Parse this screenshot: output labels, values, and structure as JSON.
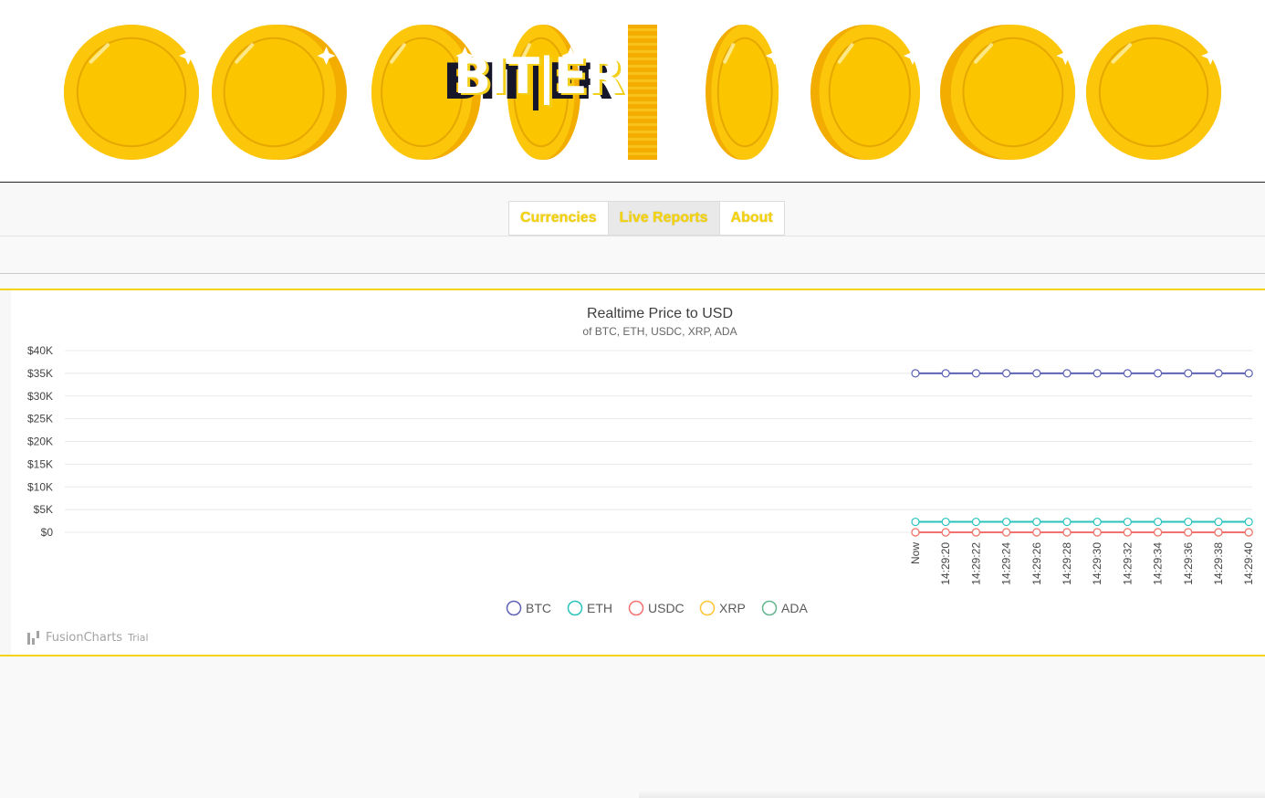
{
  "header": {
    "logo_text": "BIT|ER",
    "logo_shadow_text": "BIT|ER"
  },
  "nav": {
    "items": [
      {
        "label": "Currencies",
        "active": false
      },
      {
        "label": "Live Reports",
        "active": true
      },
      {
        "label": "About",
        "active": false
      }
    ]
  },
  "colors": {
    "accent": "#f5d40f",
    "coin": "#fcc70a",
    "coin_edge": "#f2ad00"
  },
  "chart_data": {
    "type": "line",
    "title": "Realtime Price to USD",
    "subtitle": "of BTC, ETH, USDC, XRP, ADA",
    "ylabel_ticks": [
      "$0",
      "$5K",
      "$10K",
      "$15K",
      "$20K",
      "$25K",
      "$30K",
      "$35K",
      "$40K"
    ],
    "ylim": [
      0,
      40000
    ],
    "grid": true,
    "legend_position": "bottom",
    "categories": [
      "Now",
      "14:29:20",
      "14:29:22",
      "14:29:24",
      "14:29:26",
      "14:29:28",
      "14:29:30",
      "14:29:32",
      "14:29:34",
      "14:29:36",
      "14:29:38",
      "14:29:40"
    ],
    "series": [
      {
        "name": "BTC",
        "color": "#5d62b5",
        "values": [
          35000,
          35000,
          35000,
          35000,
          35000,
          35000,
          35000,
          35000,
          35000,
          35000,
          35000,
          35000
        ]
      },
      {
        "name": "ETH",
        "color": "#29c3be",
        "values": [
          2300,
          2300,
          2300,
          2300,
          2300,
          2300,
          2300,
          2300,
          2300,
          2300,
          2300,
          2300
        ]
      },
      {
        "name": "USDC",
        "color": "#f2726f",
        "values": [
          1,
          1,
          1,
          1,
          1,
          1,
          1,
          1,
          1,
          1,
          1,
          1
        ]
      },
      {
        "name": "XRP",
        "color": "#ffc533",
        "values": [
          1,
          1,
          1,
          1,
          1,
          1,
          1,
          1,
          1,
          1,
          1,
          1
        ]
      },
      {
        "name": "ADA",
        "color": "#62b58f",
        "values": [
          1,
          1,
          1,
          1,
          1,
          1,
          1,
          1,
          1,
          1,
          1,
          1
        ]
      }
    ]
  },
  "credit": {
    "brand": "FusionCharts",
    "tag": "Trial"
  }
}
